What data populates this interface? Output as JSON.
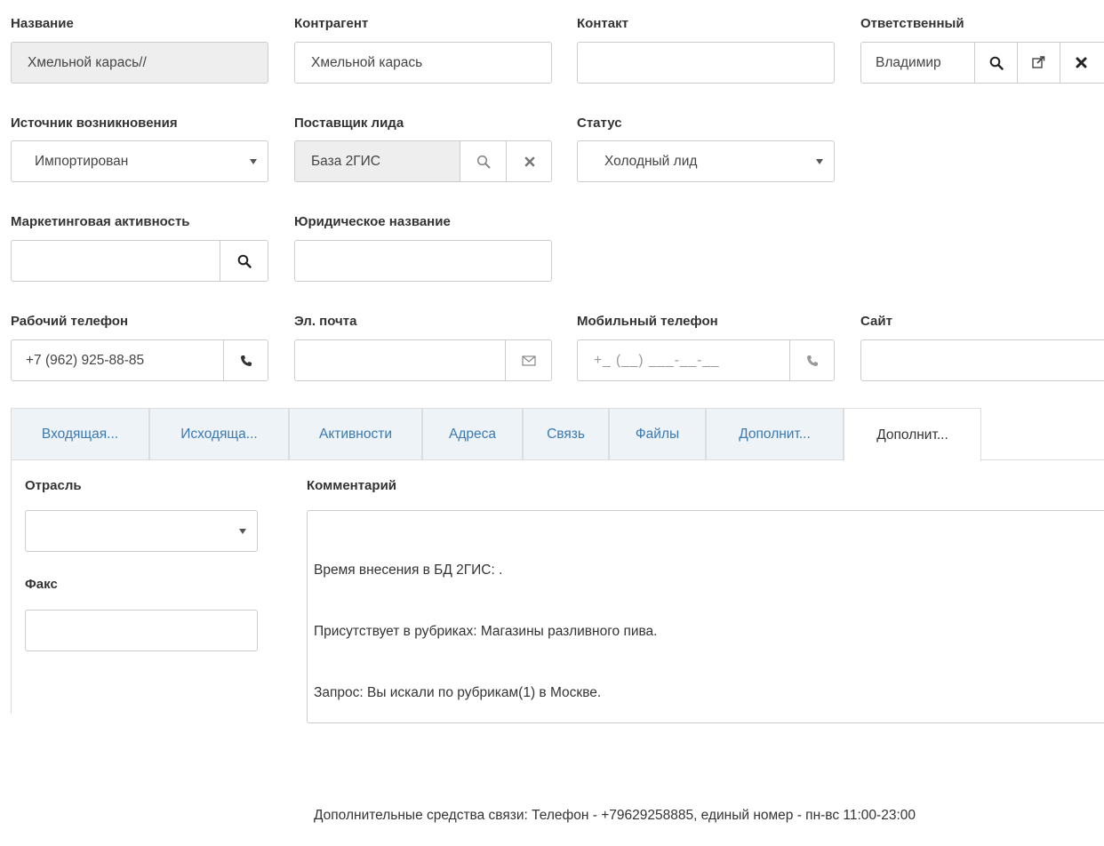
{
  "form": {
    "name": {
      "label": "Название",
      "value": "Хмельной карась//"
    },
    "counterparty": {
      "label": "Контрагент",
      "value": "Хмельной карась"
    },
    "contact": {
      "label": "Контакт",
      "value": ""
    },
    "responsible": {
      "label": "Ответственный",
      "value": "Владимир"
    },
    "source": {
      "label": "Источник возникновения",
      "value": "Импортирован"
    },
    "lead_provider": {
      "label": "Поставщик лида",
      "value": "База 2ГИС"
    },
    "status": {
      "label": "Статус",
      "value": "Холодный лид"
    },
    "marketing": {
      "label": "Маркетинговая активность",
      "value": ""
    },
    "legal_name": {
      "label": "Юридическое название",
      "value": ""
    },
    "work_phone": {
      "label": "Рабочий телефон",
      "value": "+7 (962) 925-88-85"
    },
    "email": {
      "label": "Эл. почта",
      "value": ""
    },
    "mobile_phone": {
      "label": "Мобильный телефон",
      "value": "",
      "mask": "+_ (__) ___-__-__"
    },
    "site": {
      "label": "Сайт",
      "value": ""
    }
  },
  "tabs": [
    {
      "label": "Входящая..."
    },
    {
      "label": "Исходяща..."
    },
    {
      "label": "Активности"
    },
    {
      "label": "Адреса"
    },
    {
      "label": "Связь"
    },
    {
      "label": "Файлы"
    },
    {
      "label": "Дополнит..."
    },
    {
      "label": "Дополнит...",
      "active": true
    }
  ],
  "panel": {
    "industry": {
      "label": "Отрасль",
      "value": ""
    },
    "fax": {
      "label": "Факс",
      "value": ""
    },
    "comment": {
      "label": "Комментарий",
      "lines": [
        "Время внесения в БД 2ГИС: .",
        "Присутствует в рубриках: Магазины разливного пива.",
        "Запрос: Вы искали по рубрикам(1) в Москве.",
        "",
        "Дополнительные средства связи: Телефон - +79629258885, единый номер - пн-вс 11:00-23:00"
      ]
    }
  },
  "icons": {
    "search": "search-icon",
    "external": "external-link-icon",
    "clear": "close-icon",
    "phone": "phone-icon",
    "mail": "envelope-icon"
  },
  "colors": {
    "tab_link": "#3b79b0",
    "tab_bg": "#edf3f7",
    "readonly_bg": "#eeeeee",
    "border": "#cccccc"
  }
}
